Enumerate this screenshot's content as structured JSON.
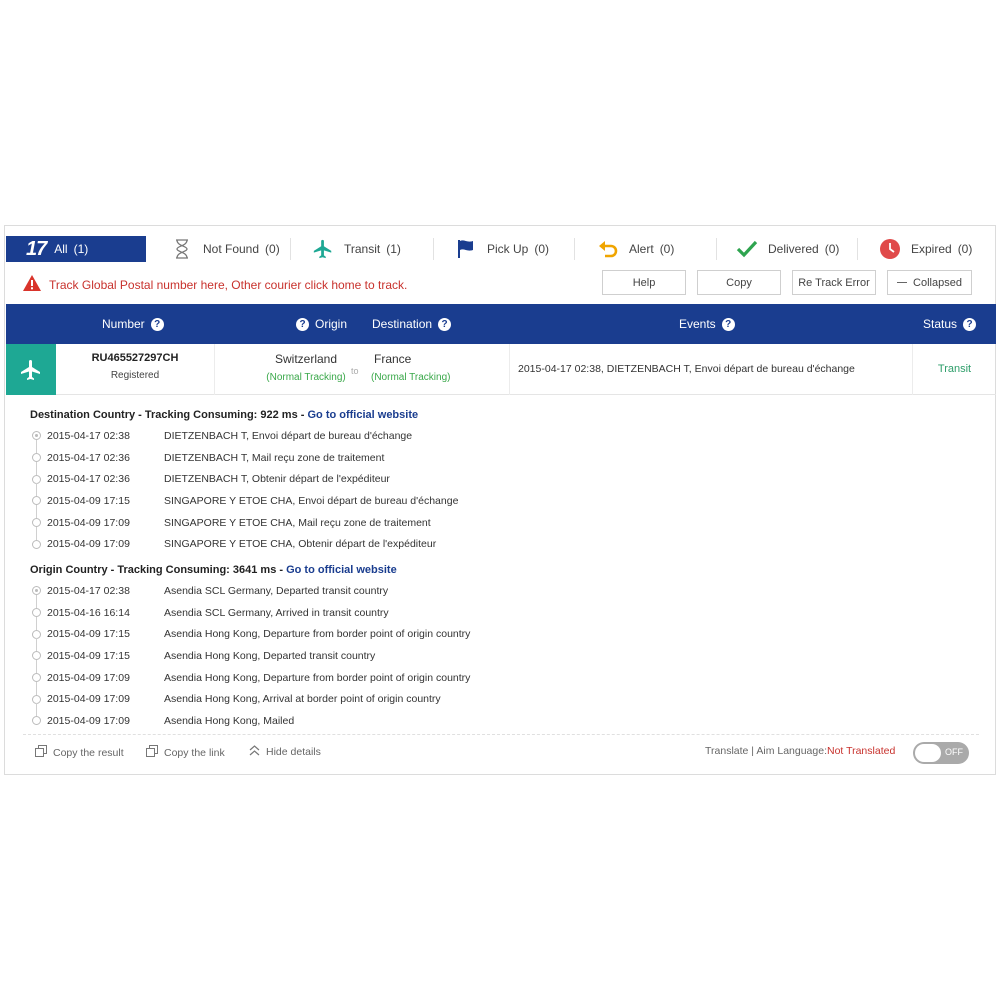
{
  "filters": {
    "all": {
      "logo": "17",
      "label": "All",
      "count": "(1)"
    },
    "not_found": {
      "label": "Not Found",
      "count": "(0)"
    },
    "transit": {
      "label": "Transit",
      "count": "(1)"
    },
    "pick_up": {
      "label": "Pick Up",
      "count": "(0)"
    },
    "alert": {
      "label": "Alert",
      "count": "(0)"
    },
    "delivered": {
      "label": "Delivered",
      "count": "(0)"
    },
    "expired": {
      "label": "Expired",
      "count": "(0)"
    }
  },
  "notice": "Track Global Postal number here, Other courier click home to track.",
  "actions": {
    "help": "Help",
    "copy": "Copy",
    "retrack": "Re Track Error",
    "collapsed": "Collapsed"
  },
  "header": {
    "number": "Number",
    "origin": "Origin",
    "destination": "Destination",
    "events": "Events",
    "status": "Status"
  },
  "shipment": {
    "number": "RU465527297CH",
    "type": "Registered",
    "origin": "Switzerland",
    "origin_note": "(Normal Tracking)",
    "to": "to",
    "destination": "France",
    "destination_note": "(Normal Tracking)",
    "latest_event": "2015-04-17 02:38, DIETZENBACH T, Envoi départ de bureau d'échange",
    "status": "Transit"
  },
  "destination_section": {
    "title": "Destination Country - Tracking Consuming: 922 ms - ",
    "link": "Go to official website",
    "events": [
      {
        "time": "2015-04-17 02:38",
        "desc": "DIETZENBACH T, Envoi départ de bureau d'échange"
      },
      {
        "time": "2015-04-17 02:36",
        "desc": "DIETZENBACH T, Mail reçu zone de traitement"
      },
      {
        "time": "2015-04-17 02:36",
        "desc": "DIETZENBACH T, Obtenir départ de l'expéditeur"
      },
      {
        "time": "2015-04-09 17:15",
        "desc": "SINGAPORE Y ETOE CHA, Envoi départ de bureau d'échange"
      },
      {
        "time": "2015-04-09 17:09",
        "desc": "SINGAPORE Y ETOE CHA, Mail reçu zone de traitement"
      },
      {
        "time": "2015-04-09 17:09",
        "desc": "SINGAPORE Y ETOE CHA, Obtenir départ de l'expéditeur"
      }
    ]
  },
  "origin_section": {
    "title": "Origin Country - Tracking Consuming: 3641 ms - ",
    "link": "Go to official website",
    "events": [
      {
        "time": "2015-04-17 02:38",
        "desc": "Asendia SCL Germany, Departed transit country"
      },
      {
        "time": "2015-04-16 16:14",
        "desc": "Asendia SCL Germany, Arrived in transit country"
      },
      {
        "time": "2015-04-09 17:15",
        "desc": "Asendia Hong Kong, Departure from border point of origin country"
      },
      {
        "time": "2015-04-09 17:15",
        "desc": "Asendia Hong Kong, Departed transit country"
      },
      {
        "time": "2015-04-09 17:09",
        "desc": "Asendia Hong Kong, Departure from border point of origin country"
      },
      {
        "time": "2015-04-09 17:09",
        "desc": "Asendia Hong Kong, Arrival at border point of origin country"
      },
      {
        "time": "2015-04-09 17:09",
        "desc": "Asendia Hong Kong, Mailed"
      }
    ]
  },
  "footer": {
    "copy_result": "Copy the result",
    "copy_link": "Copy the link",
    "hide_details": "Hide details",
    "translate_prefix": "Translate | Aim Language: ",
    "translate_value": "Not Translated",
    "toggle": "OFF"
  },
  "colors": {
    "brand": "#1a3d8f",
    "teal": "#1ea894",
    "alert_red": "#c8322d",
    "status_green": "#2e9e6a",
    "note_green": "#3aa84a"
  }
}
